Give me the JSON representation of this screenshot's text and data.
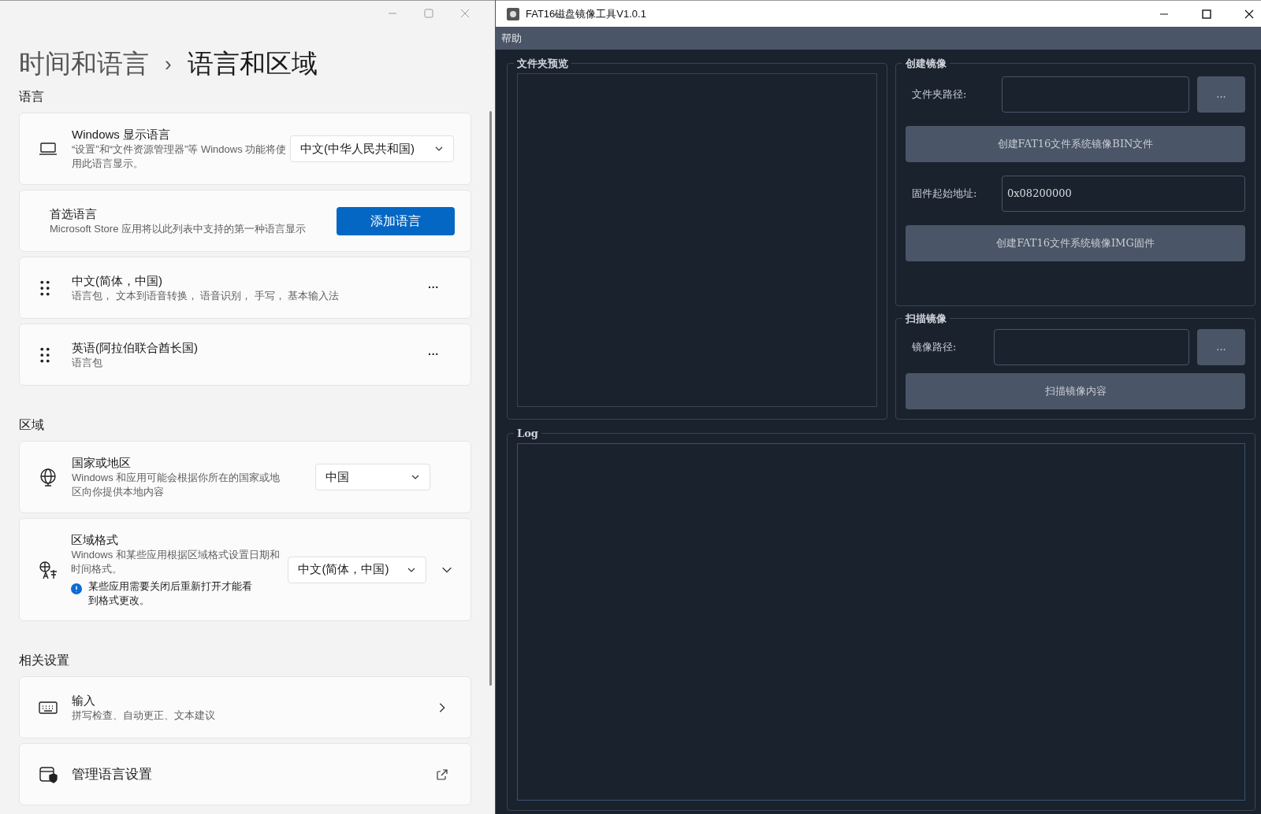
{
  "settings_window": {
    "breadcrumb": {
      "parent": "时间和语言",
      "separator": "›",
      "current": "语言和区域"
    },
    "sections": [
      {
        "title": "语言",
        "cards": [
          {
            "kind": "dropdown",
            "title": "Windows 显示语言",
            "description": "“设置”和“文件资源管理器”等 Windows 功能将使用此语言显示。",
            "value": "中文(中华人民共和国)"
          },
          {
            "kind": "button",
            "title": "首选语言",
            "description": "Microsoft Store 应用将以此列表中支持的第一种语言显示",
            "button": "添加语言"
          },
          {
            "kind": "language",
            "title": "中文(简体，中国)",
            "description": "语言包， 文本到语音转换， 语音识别， 手写， 基本输入法",
            "more": "···"
          },
          {
            "kind": "language",
            "title": "英语(阿拉伯联合酋长国)",
            "description": "语言包",
            "more": "···"
          }
        ]
      },
      {
        "title": "区域",
        "cards": [
          {
            "kind": "dropdown",
            "title": "国家或地区",
            "description": "Windows 和应用可能会根据你所在的国家或地区向你提供本地内容",
            "value": "中国"
          },
          {
            "kind": "expandable",
            "title": "区域格式",
            "description": "Windows 和某些应用根据区域格式设置日期和时间格式。",
            "note": "某些应用需要关闭后重新打开才能看到格式更改。",
            "value": "中文(简体，中国)",
            "expanded": false
          }
        ]
      },
      {
        "title": "相关设置",
        "cards": [
          {
            "kind": "link",
            "title": "输入",
            "description": "拼写检查、自动更正、文本建议"
          },
          {
            "kind": "external",
            "title": "管理语言设置"
          }
        ]
      }
    ]
  },
  "tool_window": {
    "title": "FAT16磁盘镜像工具V1.0.1",
    "menu": [
      "帮助"
    ],
    "preview": {
      "title": "文件夹预览"
    },
    "create": {
      "title": "创建镜像",
      "folder_label": "文件夹路径:",
      "browse": "...",
      "bin_button": "创建FAT16文件系统镜像BIN文件",
      "address_label": "固件起始地址:",
      "address_value": "0x08200000",
      "img_button": "创建FAT16文件系统镜像IMG固件"
    },
    "scan": {
      "title": "扫描镜像",
      "image_label": "镜像路径:",
      "browse": "...",
      "scan_button": "扫描镜像内容"
    },
    "log": {
      "title": "Log"
    }
  }
}
